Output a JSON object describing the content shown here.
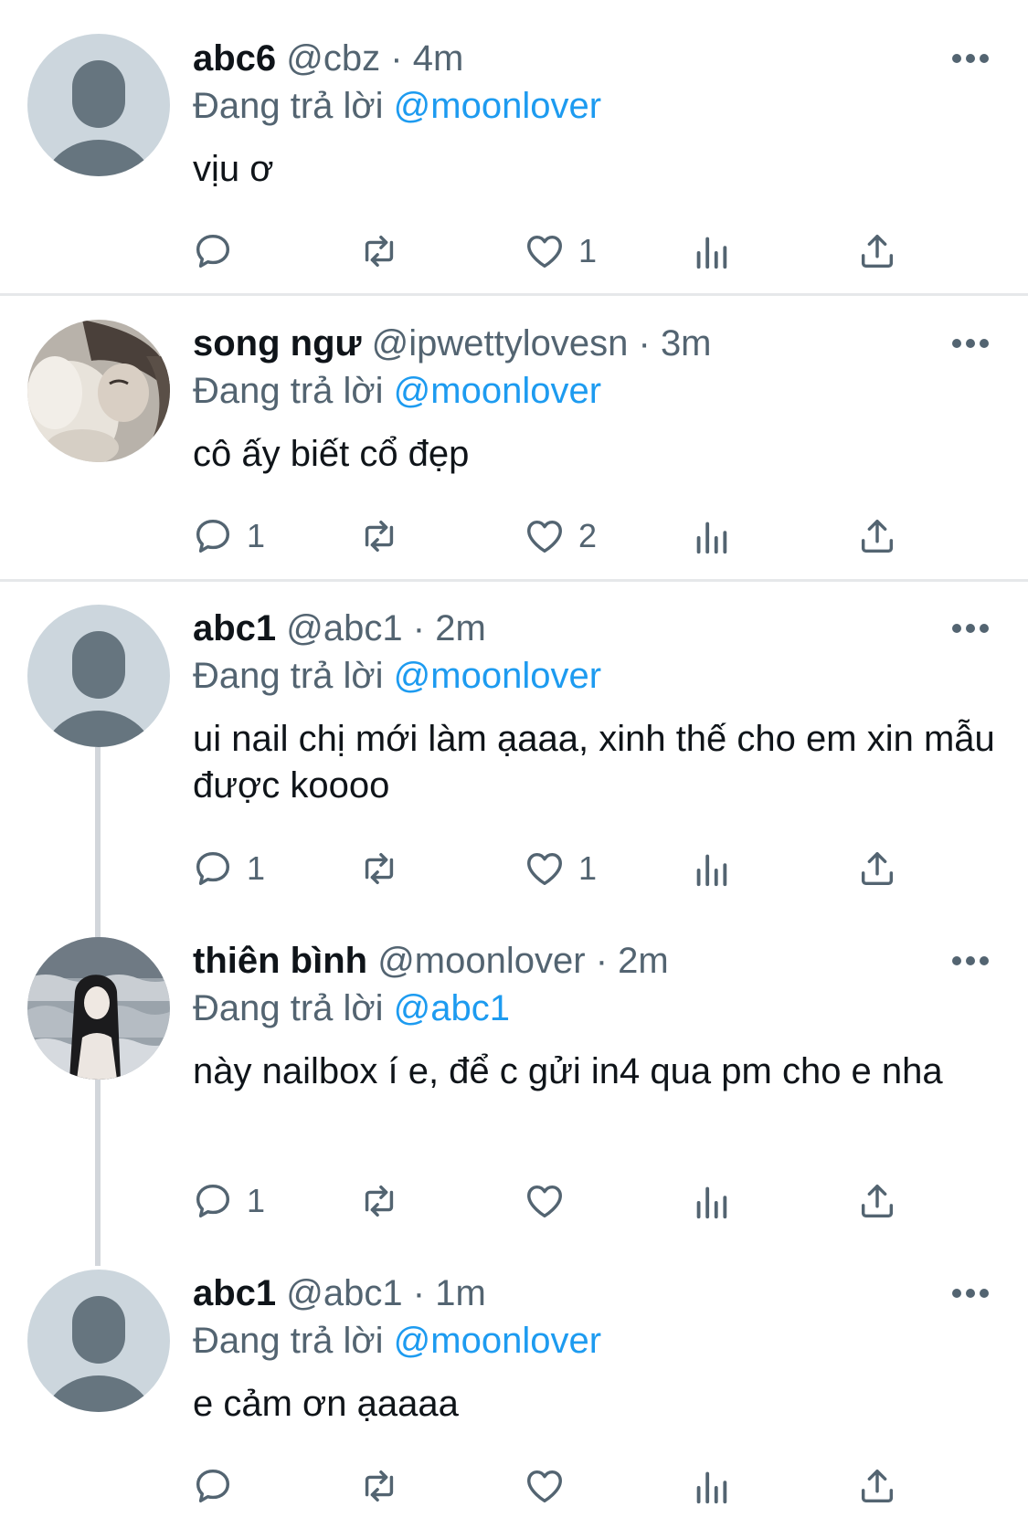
{
  "reply_label": "Đang trả lời",
  "tweets": [
    {
      "name": "abc6",
      "handle": "@cbz",
      "separator": "·",
      "time": "4m",
      "reply_to": "@moonlover",
      "text": "vịu ơ",
      "avatar": "default-avatar",
      "replies": "",
      "likes": "1"
    },
    {
      "name": "song ngư",
      "handle": "@ipwettylovesn",
      "separator": "·",
      "time": "3m",
      "reply_to": "@moonlover",
      "text": "cô ấy biết cổ đẹp",
      "avatar": "photo-avatar-girl-fur",
      "replies": "1",
      "likes": "2"
    },
    {
      "name": "abc1",
      "handle": "@abc1",
      "separator": "·",
      "time": "2m",
      "reply_to": "@moonlover",
      "text": "ui nail chị mới làm ạaaa, xinh thế cho em xin mẫu được koooo",
      "avatar": "default-avatar",
      "replies": "1",
      "likes": "1"
    },
    {
      "name": "thiên bình",
      "handle": "@moonlover",
      "separator": "·",
      "time": "2m",
      "reply_to": "@abc1",
      "text": "này nailbox í e, để c gửi in4 qua pm cho e nha",
      "avatar": "photo-avatar-girl-sea",
      "replies": "1",
      "likes": ""
    },
    {
      "name": "abc1",
      "handle": "@abc1",
      "separator": "·",
      "time": "1m",
      "reply_to": "@moonlover",
      "text": "e cảm ơn ạaaaa",
      "avatar": "default-avatar",
      "replies": "",
      "likes": ""
    }
  ],
  "colors": {
    "text": "#0f1419",
    "secondary": "#536471",
    "mention": "#1d9bf0",
    "avatar_bg": "#ccd6dd",
    "separator": "#e6e8ea",
    "thread_line": "#d2d6db"
  }
}
